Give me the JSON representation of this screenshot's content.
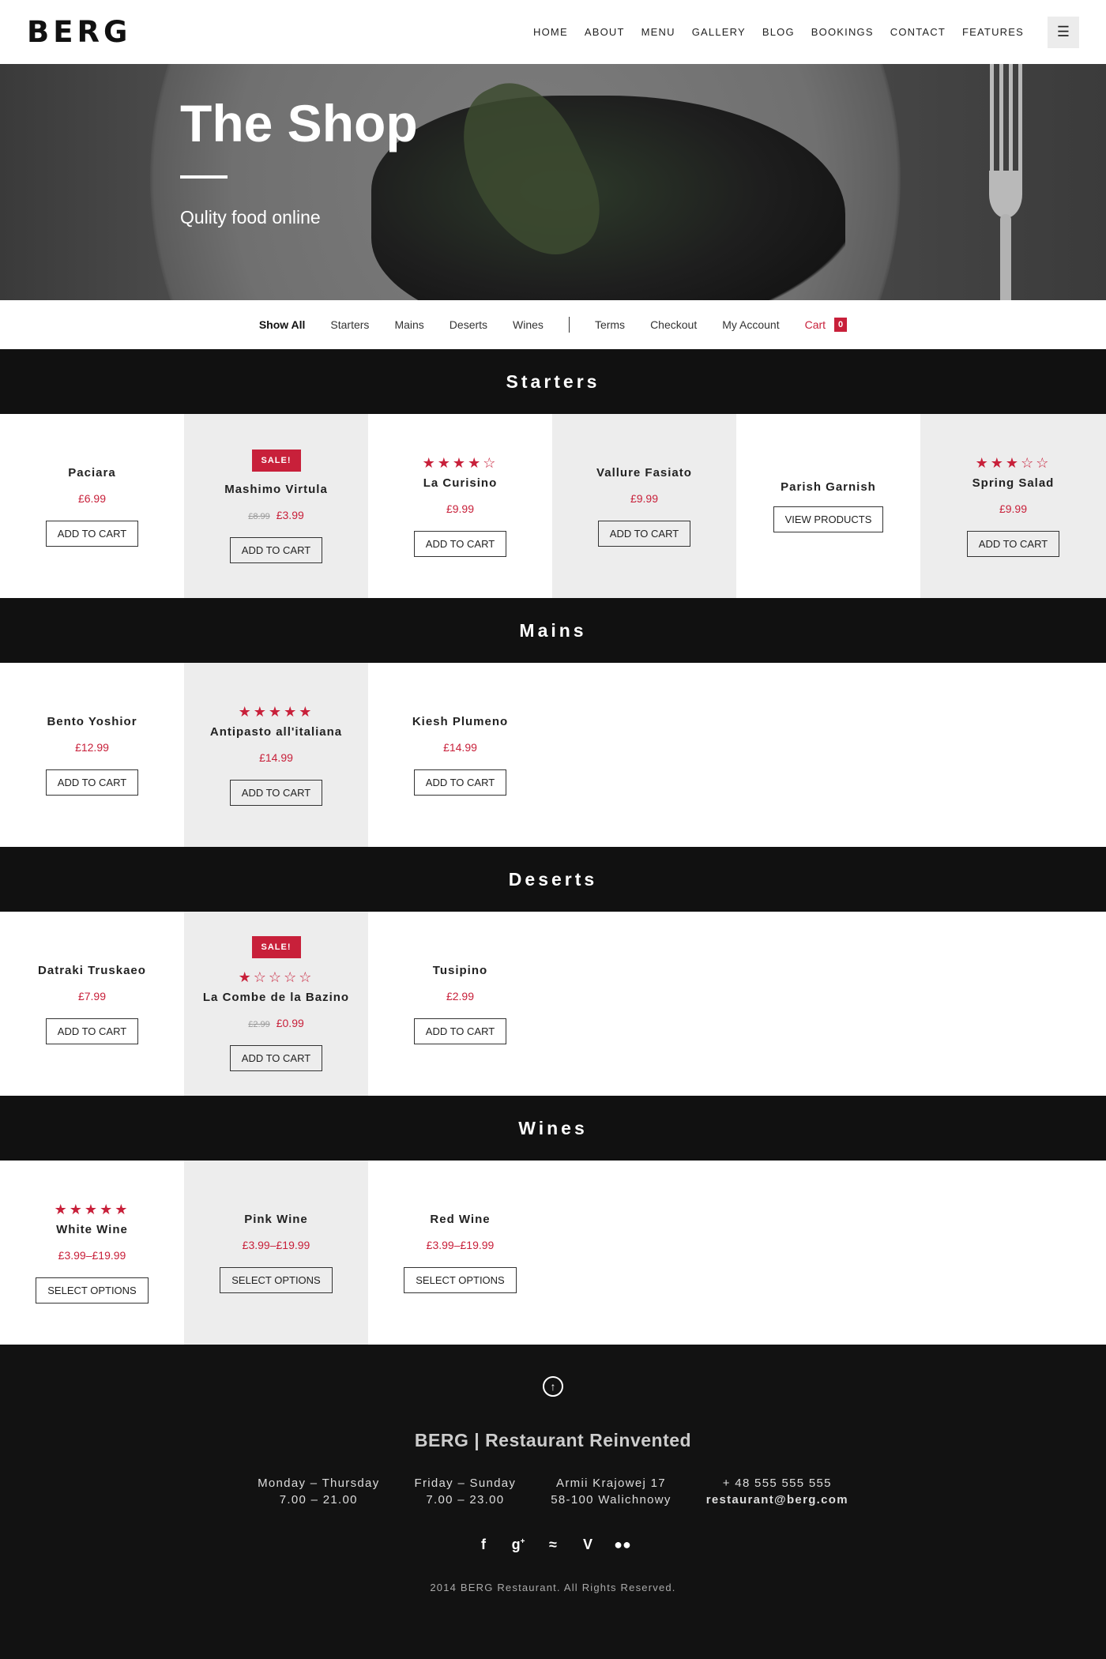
{
  "header": {
    "logo": "BERG",
    "nav": [
      "HOME",
      "ABOUT",
      "MENU",
      "GALLERY",
      "BLOG",
      "BOOKINGS",
      "CONTACT",
      "FEATURES"
    ],
    "menu_icon": "hamburger-icon"
  },
  "hero": {
    "title": "The Shop",
    "subtitle": "Qulity food online"
  },
  "filters": {
    "items": [
      "Show All",
      "Starters",
      "Mains",
      "Deserts",
      "Wines"
    ],
    "active": "Show All",
    "links": [
      "Terms",
      "Checkout",
      "My Account"
    ],
    "cart_label": "Cart",
    "cart_count": "0"
  },
  "categories": [
    {
      "title": "Starters",
      "products": [
        {
          "name": "Paciara",
          "price": "£6.99",
          "button": "ADD TO CART"
        },
        {
          "name": "Mashimo Virtula",
          "sale": "SALE!",
          "old_price": "£8.99",
          "price": "£3.99",
          "button": "ADD TO CART"
        },
        {
          "name": "La Curisino",
          "rating": 4,
          "price": "£9.99",
          "button": "ADD TO CART"
        },
        {
          "name": "Vallure Fasiato",
          "price": "£9.99",
          "button": "ADD TO CART"
        },
        {
          "name": "Parish Garnish",
          "button": "VIEW PRODUCTS"
        },
        {
          "name": "Spring Salad",
          "rating": 3,
          "price": "£9.99",
          "button": "ADD TO CART"
        }
      ]
    },
    {
      "title": "Mains",
      "products": [
        {
          "name": "Bento Yoshior",
          "price": "£12.99",
          "button": "ADD TO CART"
        },
        {
          "name": "Antipasto all'italiana",
          "rating": 5,
          "price": "£14.99",
          "button": "ADD TO CART"
        },
        {
          "name": "Kiesh Plumeno",
          "price": "£14.99",
          "button": "ADD TO CART"
        }
      ]
    },
    {
      "title": "Deserts",
      "products": [
        {
          "name": "Datraki Truskaeo",
          "price": "£7.99",
          "button": "ADD TO CART"
        },
        {
          "name": "La Combe de la Bazino",
          "sale": "SALE!",
          "rating": 1,
          "old_price": "£2.99",
          "price": "£0.99",
          "button": "ADD TO CART"
        },
        {
          "name": "Tusipino",
          "price": "£2.99",
          "button": "ADD TO CART"
        }
      ]
    },
    {
      "title": "Wines",
      "products": [
        {
          "name": "White Wine",
          "rating": 5,
          "price": "£3.99–£19.99",
          "button": "SELECT OPTIONS"
        },
        {
          "name": "Pink Wine",
          "price": "£3.99–£19.99",
          "button": "SELECT OPTIONS"
        },
        {
          "name": "Red Wine",
          "price": "£3.99–£19.99",
          "button": "SELECT OPTIONS"
        }
      ]
    }
  ],
  "footer": {
    "up_icon": "arrow-up-circle-icon",
    "brand": "BERG | Restaurant Reinvented",
    "columns": [
      {
        "line1": "Monday – Thursday",
        "line2": "7.00 – 21.00"
      },
      {
        "line1": "Friday – Sunday",
        "line2": "7.00 – 23.00"
      },
      {
        "line1": "Armii Krajowej 17",
        "line2": "58-100 Walichnowy"
      },
      {
        "line1": "+ 48 555 555 555",
        "line2": "restaurant@berg.com"
      }
    ],
    "social": [
      "facebook-icon",
      "google-plus-icon",
      "spotify-icon",
      "vine-icon",
      "flickr-icon"
    ],
    "copyright": "2014 BERG Restaurant. All Rights Reserved."
  },
  "colors": {
    "accent": "#c8203a",
    "dark": "#111111",
    "alt_tile": "#ededed"
  }
}
